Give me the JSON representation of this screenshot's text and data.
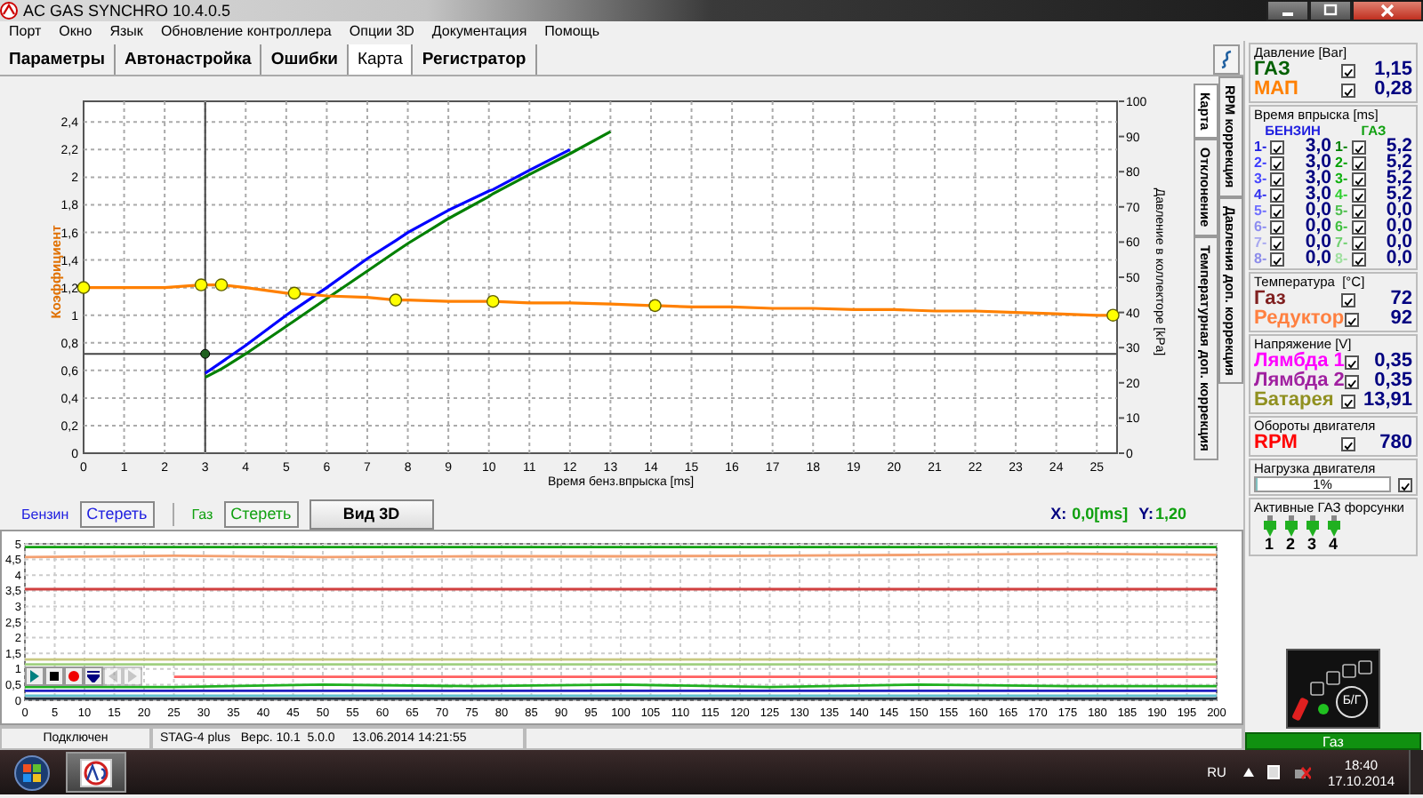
{
  "window": {
    "title": "AC GAS SYNCHRO  10.4.0.5"
  },
  "menu": [
    "Порт",
    "Окно",
    "Язык",
    "Обновление контроллера",
    "Опции 3D",
    "Документация",
    "Помощь"
  ],
  "tabs": [
    {
      "label": "Параметры",
      "selected": false
    },
    {
      "label": "Автонастройка",
      "selected": false
    },
    {
      "label": "Ошибки",
      "selected": false
    },
    {
      "label": "Карта",
      "selected": true
    },
    {
      "label": "Регистратор",
      "selected": false
    }
  ],
  "map_chart": {
    "chart_data": {
      "type": "line",
      "xlabel": "Время бенз.впрыска [ms]",
      "ylabel": "Коэффициент",
      "x": [
        0,
        1,
        2,
        2.9,
        3,
        3.4,
        4,
        5,
        5.2,
        6,
        7,
        7.7,
        8,
        9,
        10,
        10.1,
        11,
        12,
        13,
        14,
        14.1,
        15,
        16,
        17,
        18,
        19,
        20,
        21,
        22,
        23,
        24,
        25,
        25.4
      ],
      "series": [
        {
          "color": "#0000ff",
          "values": [
            null,
            null,
            null,
            null,
            0.58,
            0.66,
            0.78,
            1.0,
            1.04,
            1.2,
            1.41,
            1.54,
            1.6,
            1.76,
            1.9,
            1.91,
            2.05,
            2.2,
            null,
            null,
            null,
            null,
            null,
            null,
            null,
            null,
            null,
            null,
            null,
            null,
            null,
            null,
            null
          ]
        },
        {
          "color": "#008000",
          "values": [
            null,
            null,
            null,
            null,
            0.55,
            0.61,
            0.72,
            0.92,
            0.96,
            1.12,
            1.32,
            1.46,
            1.52,
            1.7,
            1.86,
            1.88,
            2.02,
            2.17,
            2.33,
            null,
            null,
            null,
            null,
            null,
            null,
            null,
            null,
            null,
            null,
            null,
            null,
            null,
            null
          ]
        },
        {
          "color": "#ff8000",
          "values": [
            1.2,
            1.2,
            1.2,
            1.22,
            1.22,
            1.22,
            1.2,
            1.16,
            1.16,
            1.14,
            1.13,
            1.11,
            1.11,
            1.1,
            1.1,
            1.1,
            1.09,
            1.09,
            1.08,
            1.07,
            1.07,
            1.06,
            1.06,
            1.05,
            1.05,
            1.04,
            1.04,
            1.03,
            1.03,
            1.02,
            1.01,
            1.0,
            1.0
          ]
        },
        {
          "type": "scatter",
          "color": "#ffff00",
          "values": [
            1.2,
            null,
            null,
            1.22,
            null,
            1.22,
            null,
            null,
            1.16,
            null,
            null,
            1.11,
            null,
            null,
            null,
            1.1,
            null,
            null,
            null,
            null,
            1.07,
            null,
            null,
            null,
            null,
            null,
            null,
            null,
            null,
            null,
            null,
            null,
            1.0
          ]
        }
      ],
      "xlim": [
        0,
        25.5
      ],
      "ylim": [
        0,
        2.55
      ],
      "grid": true,
      "xticks": [
        0,
        1,
        2,
        3,
        4,
        5,
        6,
        7,
        8,
        9,
        10,
        11,
        12,
        13,
        14,
        15,
        16,
        17,
        18,
        19,
        20,
        21,
        22,
        23,
        24,
        25
      ],
      "yticks": [
        {
          "value": 0,
          "label": "0"
        },
        {
          "value": 0.2,
          "label": "0,2"
        },
        {
          "value": 0.4,
          "label": "0,4"
        },
        {
          "value": 0.6,
          "label": "0,6"
        },
        {
          "value": 0.8,
          "label": "0,8"
        },
        {
          "value": 1,
          "label": "1"
        },
        {
          "value": 1.2,
          "label": "1,2"
        },
        {
          "value": 1.4,
          "label": "1,4"
        },
        {
          "value": 1.6,
          "label": "1,6"
        },
        {
          "value": 1.8,
          "label": "1,8"
        },
        {
          "value": 2,
          "label": "2"
        },
        {
          "value": 2.2,
          "label": "2,2"
        },
        {
          "value": 2.4,
          "label": "2,4"
        }
      ],
      "ref_lines": [
        {
          "axis": "x",
          "value": 3
        },
        {
          "axis": "y",
          "value": 0.72
        }
      ]
    },
    "right_axis": {
      "label": "Давление в коллекторе [kPa]",
      "ticks": [
        "100",
        "90",
        "80",
        "70",
        "60",
        "50",
        "40",
        "30",
        "20",
        "10",
        "0"
      ]
    }
  },
  "side_tabs": [
    {
      "label": "Карта",
      "selected": true
    },
    {
      "label": "RPM коррекция",
      "selected": false
    },
    {
      "label": "Отклонение",
      "selected": false
    },
    {
      "label": "Давления доп. коррекция",
      "selected": false
    },
    {
      "label": "Температурная доп. коррекция",
      "selected": false
    }
  ],
  "controls": {
    "petrol_label": "Бензин",
    "petrol_clear": "Стереть",
    "gas_label": "Газ",
    "gas_clear": "Стереть",
    "view_3d": "Вид 3D",
    "x_label": "X:",
    "x_value": "0,0[ms]",
    "y_label": "Y:",
    "y_value": "1,20"
  },
  "recorder_chart": {
    "chart_data": {
      "type": "line",
      "x": [
        0,
        25,
        50,
        75,
        100,
        125,
        150,
        175,
        200
      ],
      "series": [
        {
          "color": "#10a010",
          "values": [
            4.9,
            4.9,
            4.9,
            4.9,
            4.9,
            4.9,
            4.9,
            4.9,
            4.9
          ]
        },
        {
          "color": "#f4a070",
          "values": [
            4.58,
            4.62,
            4.58,
            4.6,
            4.6,
            4.62,
            4.65,
            4.68,
            4.65
          ]
        },
        {
          "color": "#d04040",
          "values": [
            3.55,
            3.55,
            3.55,
            3.55,
            3.55,
            3.55,
            3.55,
            3.55,
            3.55
          ]
        },
        {
          "color": "#c8c880",
          "values": [
            1.3,
            1.3,
            1.3,
            1.3,
            1.3,
            1.3,
            1.3,
            1.3,
            1.3
          ]
        },
        {
          "color": "#a0d080",
          "values": [
            1.15,
            1.15,
            1.15,
            1.15,
            1.15,
            1.15,
            1.15,
            1.15,
            1.15
          ]
        },
        {
          "color": "#ff6060",
          "values": [
            null,
            0.75,
            0.75,
            0.75,
            0.75,
            0.75,
            0.75,
            0.75,
            0.75
          ]
        },
        {
          "color": "#20b020",
          "values": [
            0.42,
            0.42,
            0.5,
            0.45,
            0.5,
            0.42,
            0.5,
            0.45,
            0.45
          ]
        },
        {
          "color": "#2020c0",
          "values": [
            0.3,
            0.3,
            0.3,
            0.3,
            0.3,
            0.3,
            0.3,
            0.3,
            0.3
          ]
        },
        {
          "color": "#60c0d0",
          "values": [
            0.15,
            0.15,
            0.15,
            0.15,
            0.15,
            0.15,
            0.15,
            0.15,
            0.15
          ]
        },
        {
          "color": "#203040",
          "values": [
            0.05,
            0.05,
            0.05,
            0.05,
            0.05,
            0.05,
            0.05,
            0.05,
            0.05
          ]
        }
      ],
      "xlim": [
        0,
        200
      ],
      "ylim": [
        0,
        5
      ],
      "grid": true,
      "xticks": [
        0,
        5,
        10,
        15,
        20,
        25,
        30,
        35,
        40,
        45,
        50,
        55,
        60,
        65,
        70,
        75,
        80,
        85,
        90,
        95,
        100,
        105,
        110,
        115,
        120,
        125,
        130,
        135,
        140,
        145,
        150,
        155,
        160,
        165,
        170,
        175,
        180,
        185,
        190,
        195,
        200
      ],
      "yticks": [
        {
          "value": 0,
          "label": "0"
        },
        {
          "value": 0.5,
          "label": "0,5"
        },
        {
          "value": 1,
          "label": "1"
        },
        {
          "value": 1.5,
          "label": "1,5"
        },
        {
          "value": 2,
          "label": "2"
        },
        {
          "value": 2.5,
          "label": "2,5"
        },
        {
          "value": 3,
          "label": "3"
        },
        {
          "value": 3.5,
          "label": "3,5"
        },
        {
          "value": 4,
          "label": "4"
        },
        {
          "value": 4.5,
          "label": "4,5"
        },
        {
          "value": 5,
          "label": "5"
        }
      ]
    },
    "player_buttons": [
      {
        "kind": "play",
        "disabled": false
      },
      {
        "kind": "stop",
        "disabled": false
      },
      {
        "kind": "record",
        "disabled": false
      },
      {
        "kind": "marker",
        "disabled": false
      },
      {
        "kind": "back",
        "disabled": true
      },
      {
        "kind": "forward",
        "disabled": true
      }
    ]
  },
  "panel": [
    {
      "kind": "values",
      "title": "Давление [Bar]",
      "rows": [
        {
          "label": "ГАЗ",
          "color": "#006000",
          "checked": true,
          "value": "1,15"
        },
        {
          "label": "МАП",
          "color": "#ff8000",
          "checked": true,
          "value": "0,28"
        }
      ]
    },
    {
      "kind": "injection",
      "title": "Время впрыска [ms]",
      "columns": [
        {
          "header": "БЕНЗИН",
          "color": "#2020e0",
          "items": [
            {
              "label": "1-",
              "color": "#2020e0",
              "checked": true,
              "value": "3,0"
            },
            {
              "label": "2-",
              "color": "#3a3aff",
              "checked": true,
              "value": "3,0"
            },
            {
              "label": "3-",
              "color": "#4848ff",
              "checked": true,
              "value": "3,0"
            },
            {
              "label": "4-",
              "color": "#3030f0",
              "checked": true,
              "value": "3,0"
            },
            {
              "label": "5-",
              "color": "#7070ff",
              "checked": true,
              "value": "0,0"
            },
            {
              "label": "6-",
              "color": "#8c8cf0",
              "checked": true,
              "value": "0,0"
            },
            {
              "label": "7-",
              "color": "#a8a8f0",
              "checked": true,
              "value": "0,0"
            },
            {
              "label": "8-",
              "color": "#8c8cea",
              "checked": true,
              "value": "0,0"
            }
          ]
        },
        {
          "header": "ГАЗ",
          "color": "#10a010",
          "items": [
            {
              "label": "1-",
              "color": "#008000",
              "checked": true,
              "value": "5,2"
            },
            {
              "label": "2-",
              "color": "#00a000",
              "checked": true,
              "value": "5,2"
            },
            {
              "label": "3-",
              "color": "#10b010",
              "checked": true,
              "value": "5,2"
            },
            {
              "label": "4-",
              "color": "#30d030",
              "checked": true,
              "value": "5,2"
            },
            {
              "label": "5-",
              "color": "#50c050",
              "checked": true,
              "value": "0,0"
            },
            {
              "label": "6-",
              "color": "#40c040",
              "checked": true,
              "value": "0,0"
            },
            {
              "label": "7-",
              "color": "#70d070",
              "checked": true,
              "value": "0,0"
            },
            {
              "label": "8-",
              "color": "#a0e0a0",
              "checked": true,
              "value": "0,0"
            }
          ]
        }
      ]
    },
    {
      "kind": "values",
      "title": "Температура  [°C]",
      "rows": [
        {
          "label": "Газ",
          "color": "#802020",
          "checked": true,
          "value": "72"
        },
        {
          "label": "Редуктор",
          "color": "#ff8040",
          "checked": true,
          "value": "92"
        }
      ]
    },
    {
      "kind": "values",
      "title": "Напряжение [V]",
      "rows": [
        {
          "label": "Лямбда 1",
          "color": "#ff00ff",
          "checked": true,
          "value": "0,35"
        },
        {
          "label": "Лямбда 2",
          "color": "#a020a0",
          "checked": true,
          "value": "0,35"
        },
        {
          "label": "Батарея",
          "color": "#909020",
          "checked": true,
          "value": "13,91"
        }
      ]
    },
    {
      "kind": "values",
      "title": "Обороты двигателя",
      "rows": [
        {
          "label": "RPM",
          "color": "#ff0000",
          "checked": true,
          "value": "780"
        }
      ]
    },
    {
      "kind": "load",
      "title": "Нагрузка двигателя",
      "level": 0.01,
      "value": "1%",
      "checked": true
    },
    {
      "kind": "injectors",
      "title": "Активные ГАЗ форсунки",
      "items": [
        {
          "label": "1",
          "active": true
        },
        {
          "label": "2",
          "active": true
        },
        {
          "label": "3",
          "active": true
        },
        {
          "label": "4",
          "active": true
        }
      ]
    }
  ],
  "switch": {
    "label": "Б/Г",
    "leds": [
      {
        "on": true
      },
      {
        "on": false
      },
      {
        "on": false
      },
      {
        "on": false
      },
      {
        "on": false
      }
    ],
    "indicator_on": true
  },
  "fuel_status": "Газ",
  "status_bar": [
    "Подключен",
    "STAG-4 plus   Верс. 10.1  5.0.0     13.06.2014 14:21:55"
  ],
  "taskbar": {
    "language": "RU",
    "time": "18:40",
    "date": "17.10.2014"
  }
}
